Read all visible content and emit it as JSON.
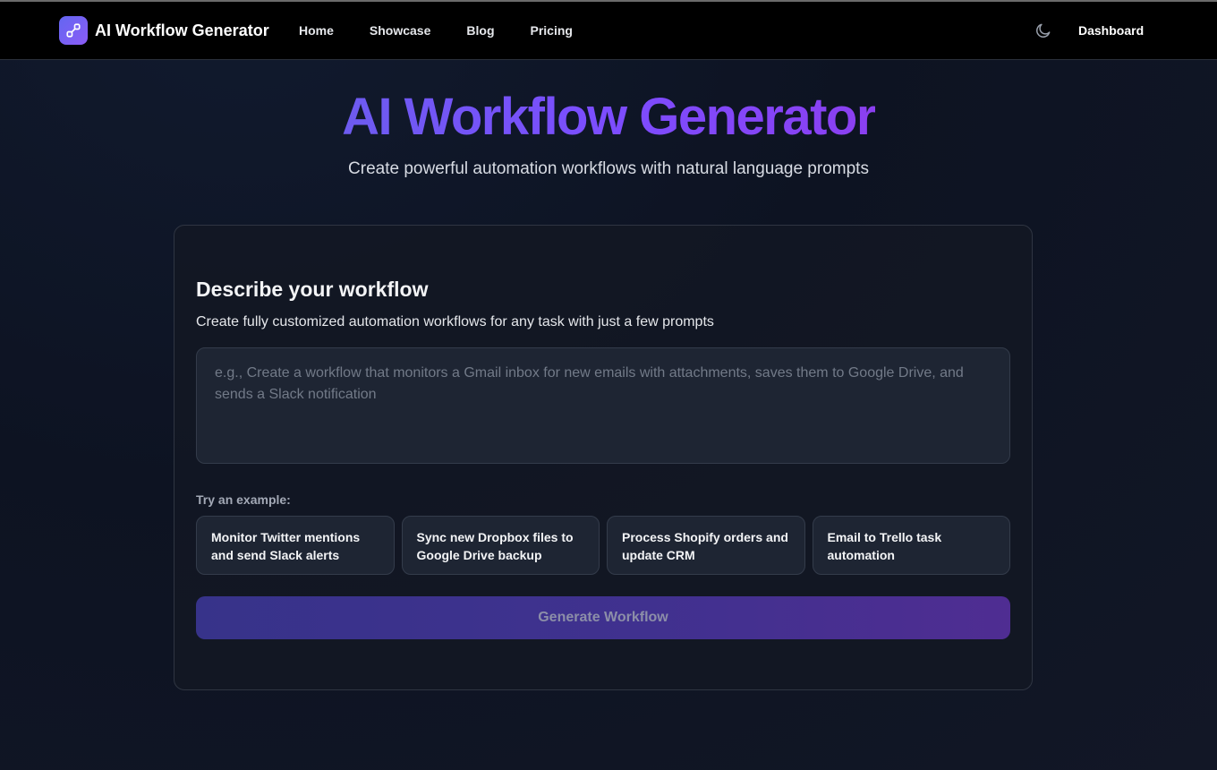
{
  "colors": {
    "accent_start": "#6366f1",
    "accent_end": "#8b5cf6",
    "navbar_bg": "#000000",
    "page_bg": "#0d1322"
  },
  "navbar": {
    "brand": "AI Workflow Generator",
    "logo_icon": "workflow-link-icon",
    "links": [
      "Home",
      "Showcase",
      "Blog",
      "Pricing"
    ],
    "theme_icon": "moon-icon",
    "dashboard": "Dashboard"
  },
  "hero": {
    "title": "AI Workflow Generator",
    "subtitle": "Create powerful automation workflows with natural language prompts"
  },
  "card": {
    "title": "Describe your workflow",
    "description": "Create fully customized automation workflows for any task with just a few prompts",
    "prompt_value": "",
    "prompt_placeholder": "e.g., Create a workflow that monitors a Gmail inbox for new emails with attachments, saves them to Google Drive, and sends a Slack notification",
    "examples_label": "Try an example:",
    "examples": [
      "Monitor Twitter mentions and send Slack alerts",
      "Sync new Dropbox files to Google Drive backup",
      "Process Shopify orders and update CRM",
      "Email to Trello task automation"
    ],
    "generate_button": "Generate Workflow"
  }
}
